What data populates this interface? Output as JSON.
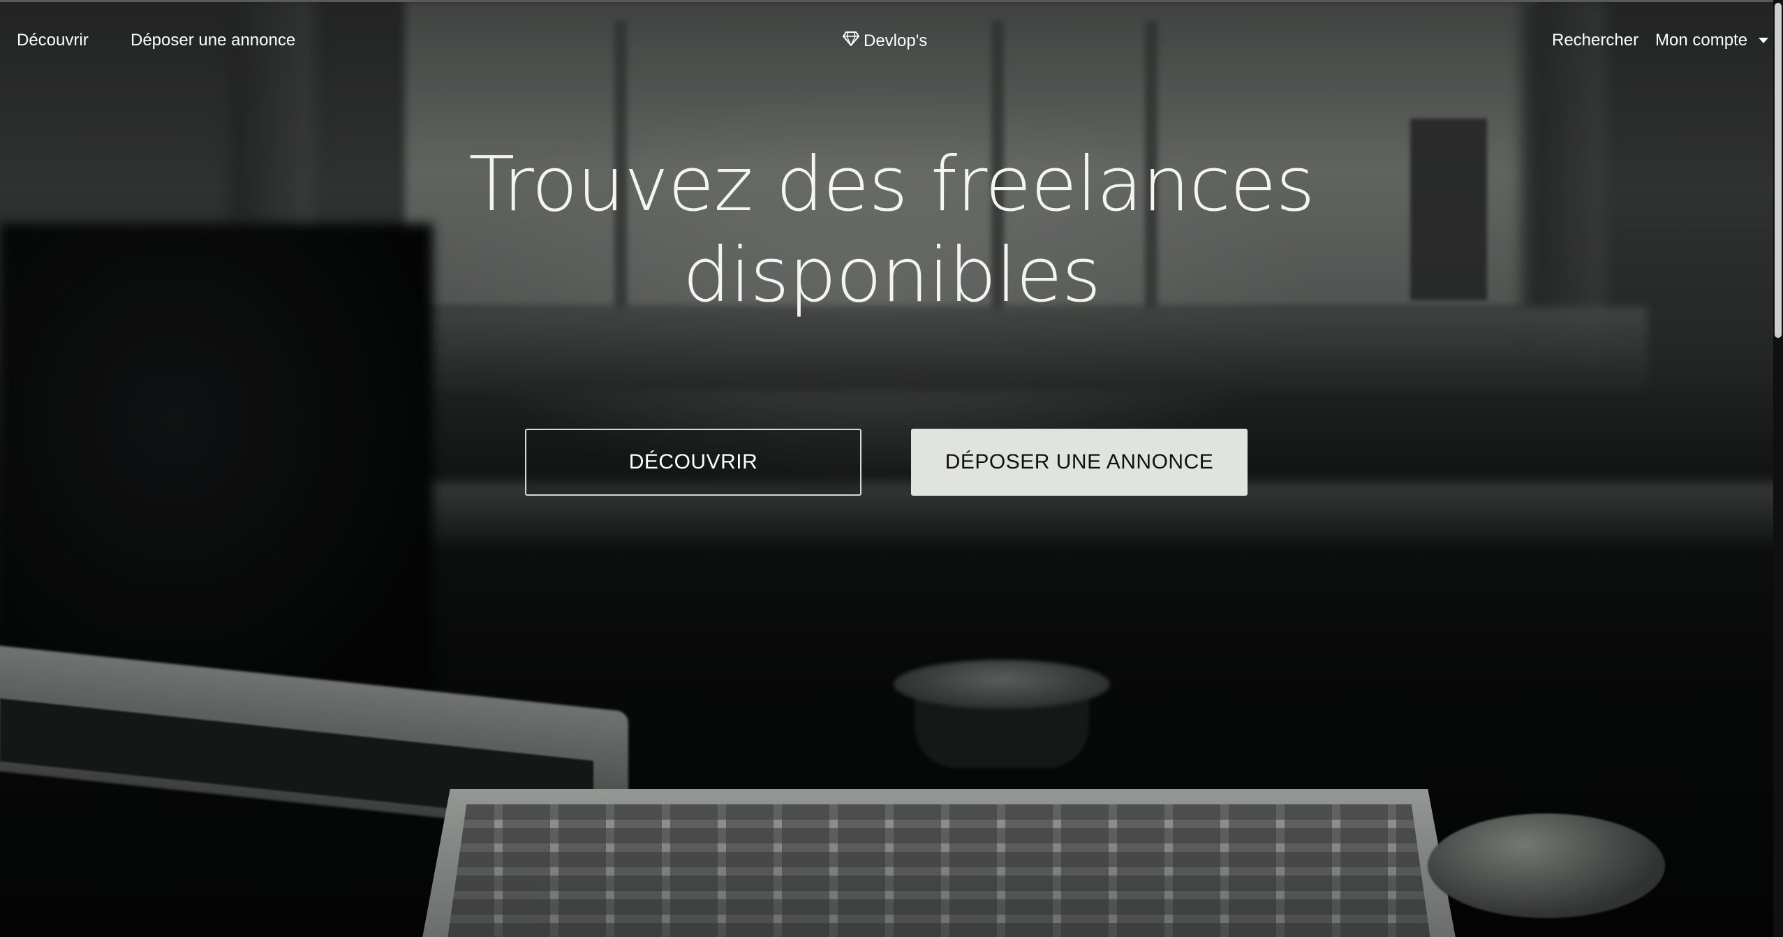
{
  "nav": {
    "left_links": [
      "Découvrir",
      "Déposer une annonce"
    ],
    "brand": {
      "icon": "diamond-icon",
      "label": "Devlop's"
    },
    "search_label": "Rechercher",
    "account_label": "Mon compte"
  },
  "hero": {
    "headline_line1": "Trouvez des freelances",
    "headline_line2": "disponibles",
    "primary_button": "DÉCOUVRIR",
    "secondary_button": "DÉPOSER UNE ANNONCE",
    "background": "desk-keyboard-photo"
  },
  "colors": {
    "text": "#ffffff",
    "solid_button_bg": "#e1e3df",
    "solid_button_text": "#111111"
  }
}
